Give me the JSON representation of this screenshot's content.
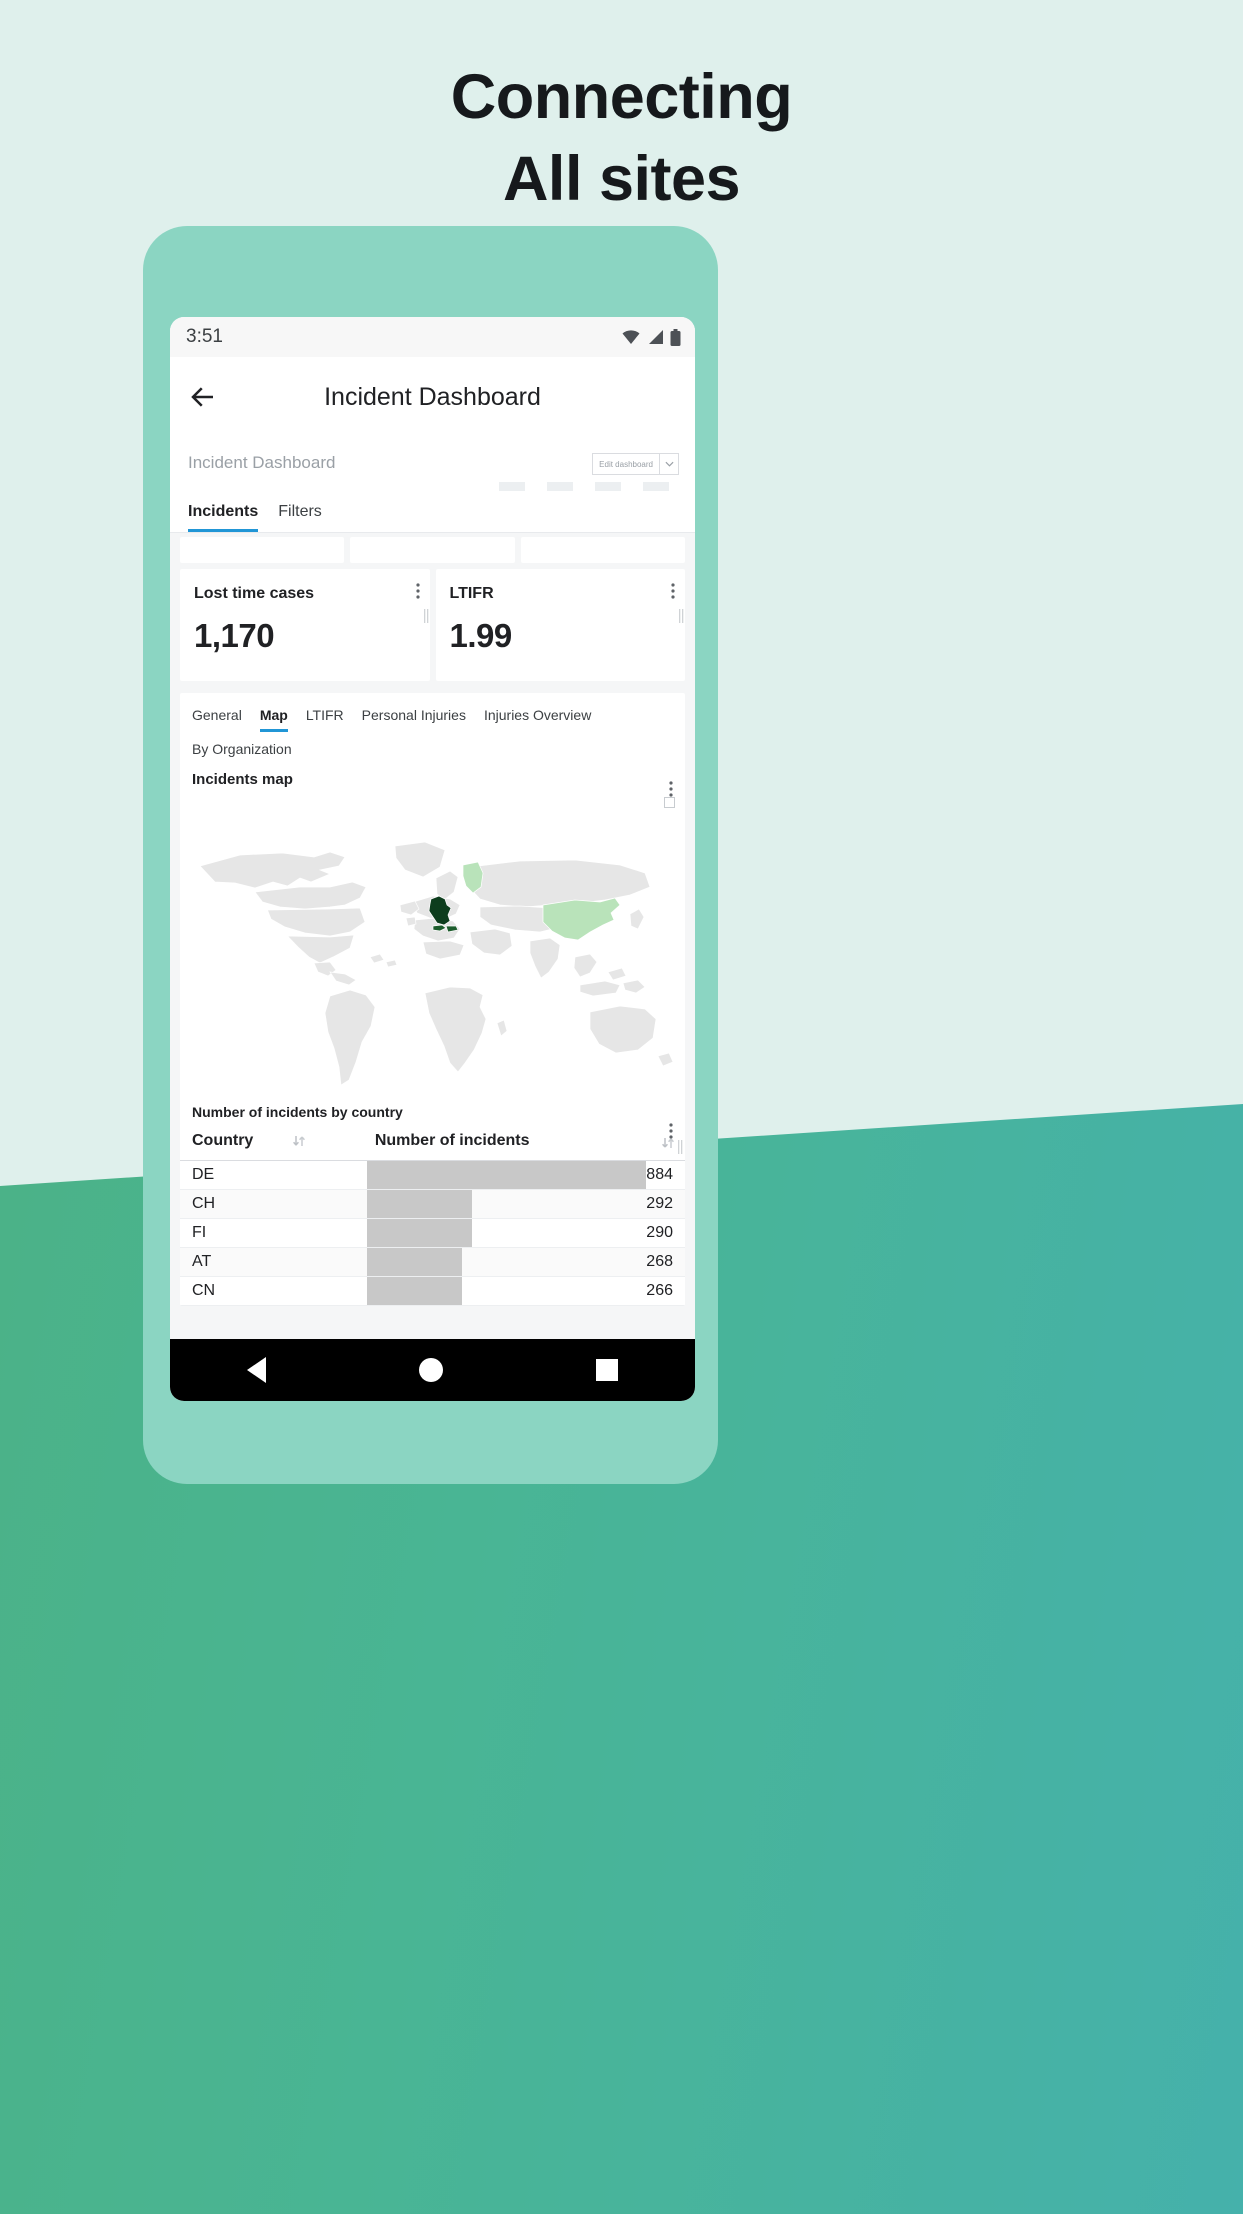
{
  "promo": {
    "line1": "Connecting",
    "line2": "All sites",
    "bg_top": "#dff0ec",
    "bg_bottom_left": "#4cb183",
    "bg_bottom_right": "#45b1ab",
    "phone_frame_color": "#8bd5c2"
  },
  "status_bar": {
    "time": "3:51",
    "icons": [
      "wifi-icon",
      "signal-icon",
      "battery-icon"
    ]
  },
  "app_bar": {
    "back_icon": "back-arrow-icon",
    "title": "Incident Dashboard"
  },
  "dashboard": {
    "name": "Incident Dashboard",
    "edit_button_label": "Edit dashboard",
    "edit_button_caret": "chevron-down-icon",
    "tabs": [
      {
        "label": "Incidents",
        "active": true
      },
      {
        "label": "Filters",
        "active": false
      }
    ],
    "accent_color": "#2196d6"
  },
  "kpis": [
    {
      "label": "Lost time cases",
      "value": "1,170"
    },
    {
      "label": "LTIFR",
      "value": "1.99"
    }
  ],
  "widget": {
    "sub_tabs": [
      {
        "label": "General",
        "active": false
      },
      {
        "label": "Map",
        "active": true
      },
      {
        "label": "LTIFR",
        "active": false
      },
      {
        "label": "Personal Injuries",
        "active": false
      },
      {
        "label": "Injuries Overview",
        "active": false
      }
    ],
    "group_by": "By Organization",
    "map_title": "Incidents map",
    "menu_icon": "more-vertical-icon",
    "expand_icon": "expand-icon"
  },
  "chart_data": {
    "type": "table",
    "title": "Number of incidents by country",
    "columns": [
      "Country",
      "Number of incidents"
    ],
    "categories": [
      "DE",
      "CH",
      "FI",
      "AT",
      "CN"
    ],
    "values": [
      884,
      292,
      290,
      268,
      266
    ],
    "max_value": 884,
    "bar_color": "#c8c8c8",
    "map": {
      "type": "choropleth",
      "highlight": [
        {
          "country": "DE",
          "value": 884,
          "color": "#0d3d1d"
        },
        {
          "country": "CH",
          "value": 292,
          "color": "#b9e3ba"
        },
        {
          "country": "FI",
          "value": 290,
          "color": "#b9e3ba"
        },
        {
          "country": "AT",
          "value": 268,
          "color": "#b9e3ba"
        },
        {
          "country": "CN",
          "value": 266,
          "color": "#b9e3ba"
        }
      ],
      "base_color": "#e6e6e6"
    }
  },
  "table_sort_icon": "sort-arrows-icon",
  "nav_bar": {
    "back": "nav-back-icon",
    "home": "nav-home-icon",
    "recents": "nav-recents-icon"
  }
}
